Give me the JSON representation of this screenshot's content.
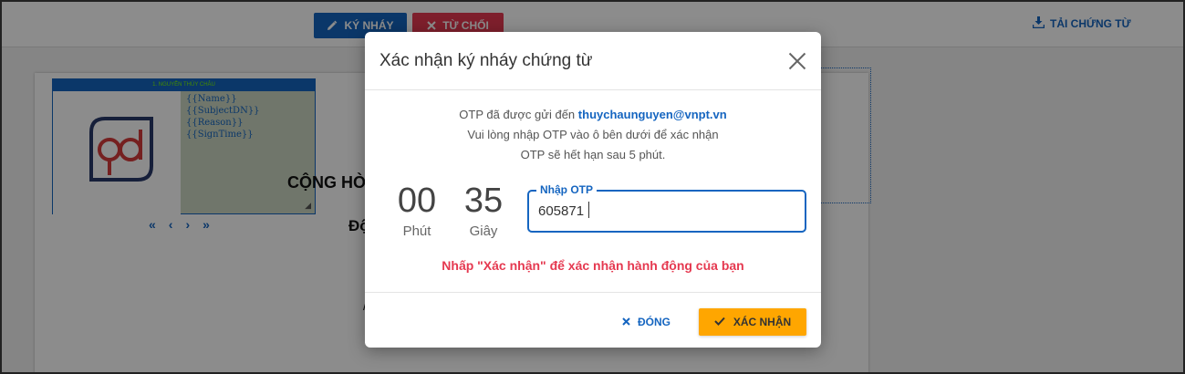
{
  "toolbar": {
    "sign_label": "KÝ NHÁY",
    "reject_label": "TỪ CHỐI",
    "download_label": "TẢI CHỨNG TỪ"
  },
  "document": {
    "signer_header": "1. NGUYỄN THÙY CHÂU",
    "fields": [
      "{{Name}}",
      "{{SubjectDN}}",
      "{{Reason}}",
      "{{SignTime}}"
    ],
    "text_1": "CỘNG HÒ",
    "text_2": "Độ",
    "text_3": "/",
    "pager": [
      "«",
      "‹",
      "›",
      "»"
    ]
  },
  "modal": {
    "title": "Xác nhận ký nháy chứng từ",
    "info_prefix": "OTP đã được gửi đến",
    "email": "thuychaunguyen@vnpt.vn",
    "info_line_2": "Vui lòng nhập OTP vào ô bên dưới để xác nhận",
    "info_line_3": "OTP sẽ hết hạn sau 5 phút.",
    "timer": {
      "minutes": "00",
      "minutes_label": "Phút",
      "seconds": "35",
      "seconds_label": "Giây"
    },
    "otp": {
      "label": "Nhập OTP",
      "value": "605871"
    },
    "warning": "Nhấp \"Xác nhận\" để xác nhận hành động của bạn",
    "close_label": "ĐÓNG",
    "confirm_label": "XÁC NHẬN"
  },
  "colors": {
    "primary": "#1565c0",
    "danger": "#e53950",
    "confirm": "#ffa600"
  }
}
